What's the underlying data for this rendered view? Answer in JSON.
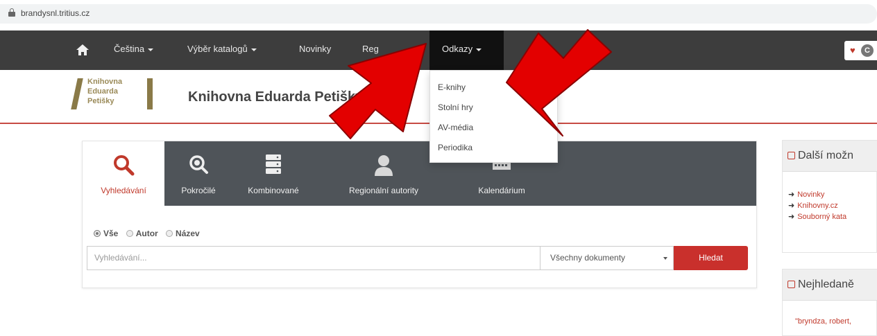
{
  "browser": {
    "url": "brandysnl.tritius.cz",
    "icon": "lock-icon"
  },
  "nav": {
    "home_icon": "home-icon",
    "items": [
      {
        "label": "Čeština",
        "has_caret": true
      },
      {
        "label": "Výběr katalogů",
        "has_caret": true
      },
      {
        "label": "Novinky",
        "has_caret": false
      },
      {
        "label": "Reg",
        "has_caret": false
      },
      {
        "label": "Odkazy",
        "has_caret": true
      }
    ],
    "active": "Odkazy",
    "right_badge_letter": "C"
  },
  "brand": {
    "logo_lines": [
      "Knihovna",
      "Eduarda",
      "Petišky"
    ],
    "title": "Knihovna Eduarda Petišky"
  },
  "dropdown": {
    "items": [
      "E-knihy",
      "Stolní hry",
      "AV-média",
      "Periodika"
    ]
  },
  "search": {
    "tabs": [
      {
        "label": "Vyhledávání",
        "icon": "search-icon",
        "active": true
      },
      {
        "label": "Pokročilé",
        "icon": "zoom-icon",
        "active": false
      },
      {
        "label": "Kombinované",
        "icon": "server-stack-icon",
        "active": false
      },
      {
        "label": "Regionální autority",
        "icon": "person-icon",
        "active": false
      },
      {
        "label": "Kalendárium",
        "icon": "calendar-icon",
        "active": false
      }
    ],
    "radios": [
      {
        "label": "Vše",
        "checked": true
      },
      {
        "label": "Autor",
        "checked": false
      },
      {
        "label": "Název",
        "checked": false
      }
    ],
    "input_placeholder": "Vyhledávání...",
    "select_value": "Všechny dokumenty",
    "button_label": "Hledat"
  },
  "sidebar": {
    "box1_title": "Další možn",
    "links": [
      "Novinky",
      "Knihovny.cz",
      "Souborný kata"
    ],
    "box2_title": "Nejhledaně",
    "box2_text": "\"bryndza, robert,"
  },
  "colors": {
    "accent": "#c9302c",
    "navbar": "#3d3d3d",
    "tabs": "#4f5459",
    "annotation": "#e30000"
  }
}
